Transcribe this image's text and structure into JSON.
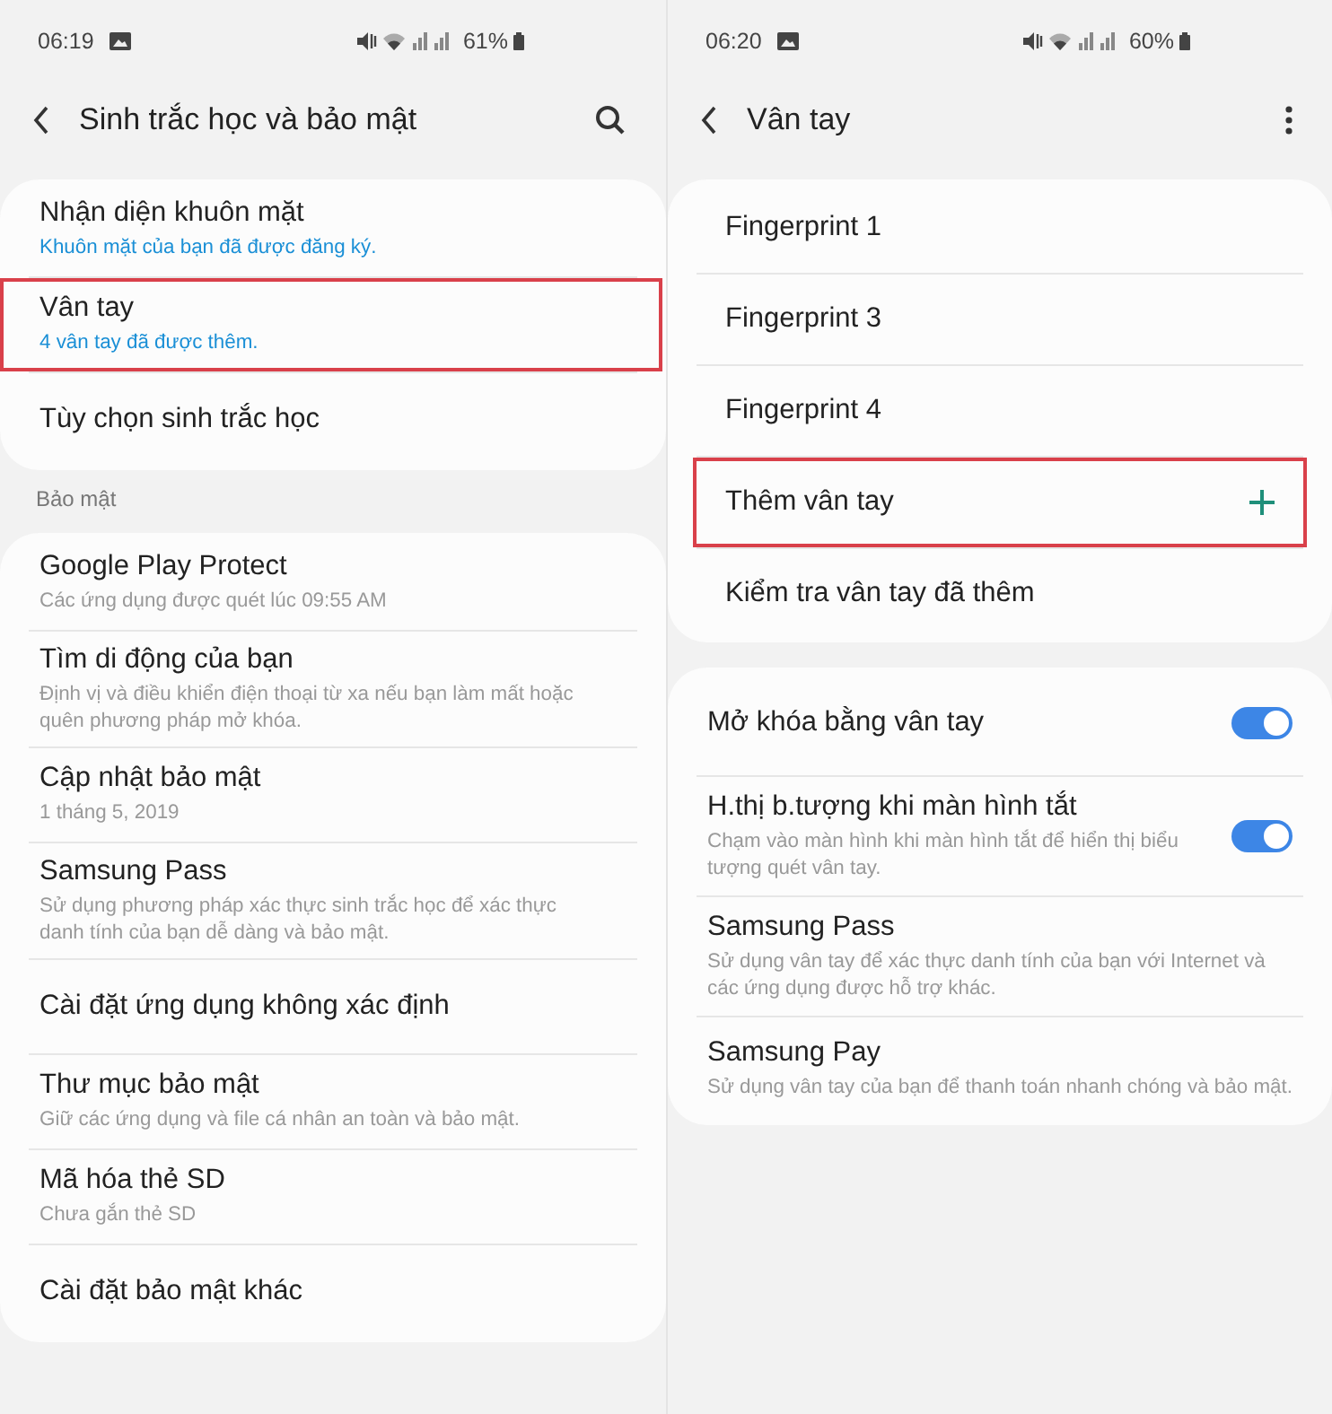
{
  "screens": [
    {
      "status_bar": {
        "time": "06:19",
        "battery": "61%"
      },
      "header": {
        "title": "Sinh trắc học và bảo mật",
        "search": true
      },
      "groups": [
        {
          "items": [
            {
              "kind": "plain",
              "title": "Nhận diện khuôn mặt",
              "subtitle": "Khuôn mặt của bạn đã được đăng ký.",
              "subtitle_accent": true,
              "highlighted": false
            },
            {
              "kind": "plain",
              "title": "Vân tay",
              "subtitle": "4 vân tay đã được thêm.",
              "subtitle_accent": true,
              "highlighted": true
            },
            {
              "kind": "plain",
              "title": "Tùy chọn sinh trắc học",
              "highlighted": false
            }
          ]
        },
        {
          "section": "Bảo mật",
          "items": [
            {
              "kind": "plain",
              "title": "Google Play Protect",
              "subtitle": "Các ứng dụng được quét lúc 09:55 AM",
              "subtitle_accent": false,
              "highlighted": false
            },
            {
              "kind": "plain",
              "title": "Tìm di động của bạn",
              "subtitle": "Định vị và điều khiển điện thoại từ xa nếu bạn làm mất hoặc quên phương pháp mở khóa.",
              "subtitle_accent": false,
              "highlighted": false
            },
            {
              "kind": "plain",
              "title": "Cập nhật bảo mật",
              "subtitle": "1 tháng 5, 2019",
              "subtitle_accent": false,
              "highlighted": false
            },
            {
              "kind": "plain",
              "title": "Samsung Pass",
              "subtitle": "Sử dụng phương pháp xác thực sinh trắc học để xác thực danh tính của bạn dễ dàng và bảo mật.",
              "subtitle_accent": false,
              "highlighted": false
            },
            {
              "kind": "plain",
              "title": "Cài đặt ứng dụng không xác định",
              "highlighted": false
            },
            {
              "kind": "plain",
              "title": "Thư mục bảo mật",
              "subtitle": "Giữ các ứng dụng và file cá nhân an toàn và bảo mật.",
              "subtitle_accent": false,
              "highlighted": false
            },
            {
              "kind": "plain",
              "title": "Mã hóa thẻ SD",
              "subtitle": "Chưa gắn thẻ SD",
              "subtitle_accent": false,
              "highlighted": false
            },
            {
              "kind": "plain",
              "title": "Cài đặt bảo mật khác",
              "highlighted": false
            }
          ]
        }
      ]
    },
    {
      "status_bar": {
        "time": "06:20",
        "battery": "60%"
      },
      "header": {
        "title": "Vân tay",
        "more_menu": true
      },
      "groups": [
        {
          "items": [
            {
              "kind": "plain",
              "title": "Fingerprint 1",
              "highlighted": false
            },
            {
              "kind": "plain",
              "title": "Fingerprint 3",
              "highlighted": false
            },
            {
              "kind": "plain",
              "title": "Fingerprint 4",
              "highlighted": false
            },
            {
              "kind": "add",
              "title": "Thêm vân tay",
              "highlighted": true
            },
            {
              "kind": "plain",
              "title": "Kiểm tra vân tay đã thêm",
              "highlighted": false
            }
          ]
        },
        {
          "items": [
            {
              "kind": "toggle",
              "title": "Mở khóa bằng vân tay",
              "on": true,
              "highlighted": false
            },
            {
              "kind": "toggle",
              "title": "H.thị b.tượng khi màn hình tắt",
              "subtitle": "Chạm vào màn hình khi màn hình tắt để hiển thị biểu tượng quét vân tay.",
              "subtitle_accent": false,
              "on": true,
              "highlighted": false
            },
            {
              "kind": "plain",
              "title": "Samsung Pass",
              "subtitle": "Sử dụng vân tay để xác thực danh tính của bạn với Internet và các ứng dụng được hỗ trợ khác.",
              "subtitle_accent": false,
              "highlighted": false
            },
            {
              "kind": "plain",
              "title": "Samsung Pay",
              "subtitle": "Sử dụng vân tay của bạn để thanh toán nhanh chóng và bảo mật.",
              "subtitle_accent": false,
              "highlighted": false
            }
          ]
        }
      ]
    }
  ]
}
